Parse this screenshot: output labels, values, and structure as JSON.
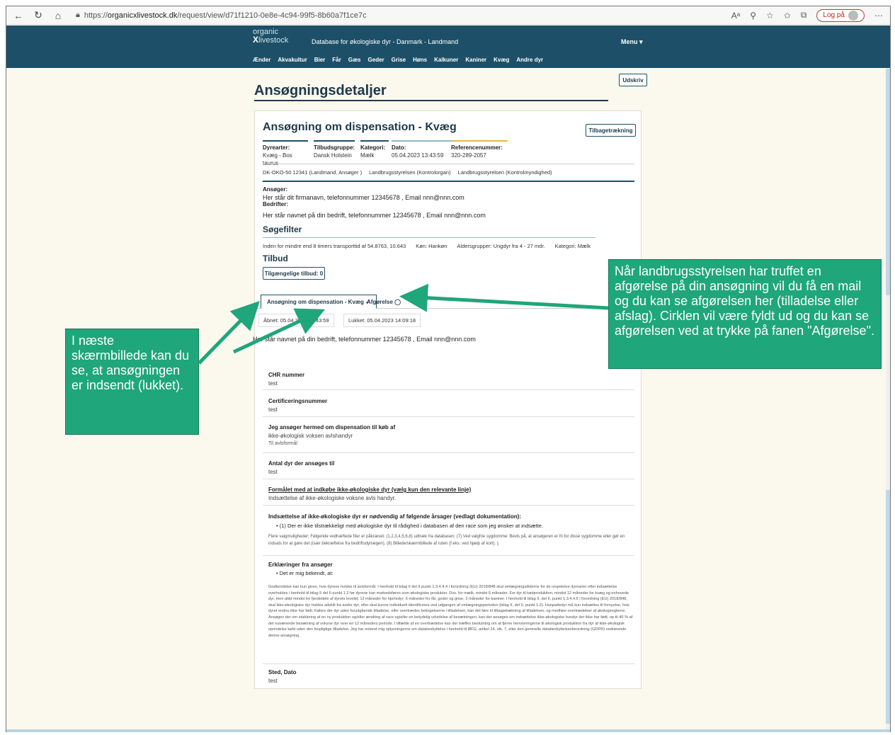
{
  "browser": {
    "url_prefix": "https://",
    "url_host": "organicxlivestock.dk",
    "url_path": "/request/view/d71f1210-0e8e-4c94-99f5-8b60a7f1ce7c",
    "login_label": "Log på"
  },
  "site": {
    "brand_top": "organic",
    "brand_bottom": "livestock",
    "brand_x": "X",
    "subtitle": "Database for økologiske dyr - Danmark - Landmand",
    "menu_label": "Menu ▾",
    "animals": [
      "Ænder",
      "Akvakultur",
      "Bier",
      "Får",
      "Gæs",
      "Geder",
      "Grise",
      "Høns",
      "Kalkuner",
      "Kaniner",
      "Kvæg",
      "Andre dyr"
    ]
  },
  "page": {
    "title": "Ansøgningsdetaljer",
    "print_button": "Udskriv"
  },
  "application": {
    "title": "Ansøgning om dispensation - Kvæg",
    "withdraw_button": "Tilbagetrækning",
    "meta": [
      {
        "label": "Dyrearter:",
        "value": "Kvæg - Bos taurus"
      },
      {
        "label": "Tilbudsgruppe:",
        "value": "Dansk Holstein"
      },
      {
        "label": "Kategori:",
        "value": "Mælk"
      },
      {
        "label": "Dato:",
        "value": "05.04.2023 13:43:59"
      },
      {
        "label": "Referencenummer:",
        "value": "320-289-2057"
      }
    ],
    "org_line": [
      "DK-OKO-50 12341 (Landmand, Ansøger )",
      "Landbrugsstyrelsen (Kontrolorgan)",
      "Landbrugsstyrelsen (Kontrolmyndighed)"
    ],
    "applicant_label": "Ansøger:",
    "applicant_text": "Her står dit firmanavn, telefonnummer 12345678 , Email nnn@nnn.com",
    "farm_label": "Bedrifter:",
    "farm_text": "Her står navnet på din bedrift, telefonnummer 12345678 , Email nnn@nnn.com",
    "filter_heading": "Søgefilter",
    "filter": [
      "Inden for mindre end 8 timers transporttid af 54.8763, 10.643",
      "Køn: Hankøn",
      "Aldersgrupper: Ungdyr fra 4 - 27 mdr.",
      "Kategori: Mælk"
    ],
    "offers_heading": "Tilbud",
    "offers_button": "Tilgængelige tilbud: 0",
    "tab_application": "Ansøgning om dispensation - Kvæg ✓",
    "tab_decision": "Afgørelse ◯",
    "opened": "Åbnet: 05.04.2023 13:43:59",
    "closed": "Lukket: 05.04.2023 14:09:18",
    "applicant_line": "Her står navnet på din bedrift, telefonnummer 12345678 , Email nnn@nnn.com",
    "fields": {
      "chr_label": "CHR nummer",
      "chr_value": "test",
      "cert_label": "Certificeringsnummer",
      "cert_value": "test",
      "purchase_label": "Jeg ansøger hermed om dispensation til køb af",
      "purchase_value": "ikke-økologisk voksen avlshandyr",
      "purchase_sub": "Til avlsformål",
      "count_label": "Antal dyr der ansøges til",
      "count_value": "test",
      "purpose_label": "Formålet med at indkøbe ikke-økologiske dyr (vælg kun den relevante linje)",
      "purpose_value": "Indsættelse af ikke-økologiske voksne avls handyr.",
      "reasons_label": "Indsættelse af ikke-økologiske dyr er nødvendig af følgende årsager (vedlagt dokumentation):",
      "reasons_bullet": "(1) Der er ikke tilstrækkeligt med økologiske dyr til rådighed i databasen af den race som jeg ønsker at indsætte.",
      "reasons_note": "Flere valgmuligheder; Følgende vedhæftede filer er påkrævet: (1,2,3,4,5,6,8) udtræk fra databasen; (7) Ved valgfrie sygdomme: Bevis på, at ansøgeren er fri for disse sygdomme eller gør en indsats for at gøre det (især bekræftelse fra bedriftsdyrlægen), (8) Billede/skærmbillede af ruten (f.eks. ved hjælp af kort). ).",
      "decl_label": "Erklæringer fra ansøger",
      "decl_bullet": "Det er mig bekendt, at:",
      "decl_text": "Godkendelse kan kun gives, hvis dyrene holdes til avlsformål. I henhold til bilag II del II punkt 1.3.4.4.4 i forordning (EU) 2018/848 skal omlægningsdiderne for de respektive dyrearter efter indsættelse overholdes i henhold til bilag II del II punkt 1.2 før dyrene kan markedsføres som økologiske produkter. Dvs. for mælk, mindst 6 måneder. For dyr til kødproduktion; mindst 12 måneder for kvæg og enhovede dyr, men altid mindst tre fjerdedele af dyrets levetid; 12 måneder for hjortedyr; 6 måneder for får, geder og grise, 3 måneder for kaniner. I henhold til bilag II, del II, punkt 1.3.4.4.5 i forordning (EU) 2018/848, skal ikke-økologiske dyr holdes adskilt fra andre dyr, eller skal kunne individuelt identificeres ved udgangen af omlægningsperioden (bilag II, del II, punkt 1.2). Hunpattedyr må kun indsættes til fornyelse, hvis dyret endnu ikke har født. Købes der dyr uden forudgående tilladelse, eller overtrædes betingelserne i tilladelsen, kan det føre til tilbagetrækning af tilladelsen, og medføre overtrædelser af økologireglerne. Ansøges der om etablering af en ny produktion og/eller ændring af race og/eller en betydelig udvidelse af besætningen, kan der ansøges om indsættelse ikke-økologiske hundyr der ikke har født, op til 40 % af det nuværende besætning af voksne dyr over en 12 måneders periode. I tilfælde af en overtrædelse kan der træffes beslutning om at fjerne henvisningerne til økologisk produktion fra dyr af ikke-økologisk oprindelse købt uden den lovpligtige tilladelse. Jeg har noteret mig oplysningerne om databeskyttelse i henhold til ØFG, artikel 24, stk. 7, eller den generelle databeskyttelsesforordning (GDPR) vedrørende denne ansøgning.",
      "place_label": "Sted, Dato",
      "place_value": "test"
    }
  },
  "annotations": {
    "left": "I næste skærmbillede kan du se, at ansøgningen er indsendt (lukket).",
    "right": "Når landbrugsstyrelsen har truffet en afgørelse på din ansøgning vil du få en mail og du kan se afgørelsen her (tilladelse eller afslag). Cirklen vil være fyldt ud og du kan se afgørelsen ved at trykke på fanen \"Afgørelse\".",
    "color": "#1fa67a"
  }
}
